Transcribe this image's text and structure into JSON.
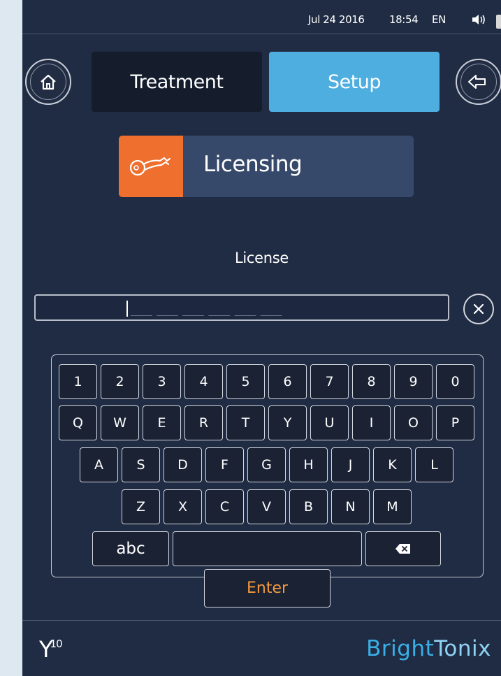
{
  "status": {
    "date": "Jul 24 2016",
    "time": "18:54",
    "language": "EN"
  },
  "tabs": {
    "treatment": "Treatment",
    "setup": "Setup"
  },
  "section": {
    "title": "Licensing",
    "icon": "key-icon"
  },
  "license": {
    "label": "License",
    "mask": "____ ____ ____ ____ ____ ____"
  },
  "keyboard": {
    "row1": [
      "1",
      "2",
      "3",
      "4",
      "5",
      "6",
      "7",
      "8",
      "9",
      "0"
    ],
    "row2": [
      "Q",
      "W",
      "E",
      "R",
      "T",
      "Y",
      "U",
      "I",
      "O",
      "P"
    ],
    "row3": [
      "A",
      "S",
      "D",
      "F",
      "G",
      "H",
      "J",
      "K",
      "L"
    ],
    "row4": [
      "Z",
      "X",
      "C",
      "V",
      "B",
      "N",
      "M"
    ],
    "abc": "abc",
    "enter": "Enter"
  },
  "footer": {
    "model": "Y",
    "model_sup": "10",
    "brand_part1": "Bright",
    "brand_part2": "Tonix"
  },
  "colors": {
    "background": "#202c43",
    "setup_tab": "#4eaee0",
    "treatment_tab": "#151d2d",
    "accent_orange": "#ee6f2e",
    "enter_text": "#f39a3c",
    "brand_blue": "#3ab0e8"
  },
  "icons": {
    "home": "home-icon",
    "back": "back-arrow-icon",
    "clear": "clear-x-icon",
    "volume": "volume-icon",
    "backspace": "backspace-icon"
  }
}
